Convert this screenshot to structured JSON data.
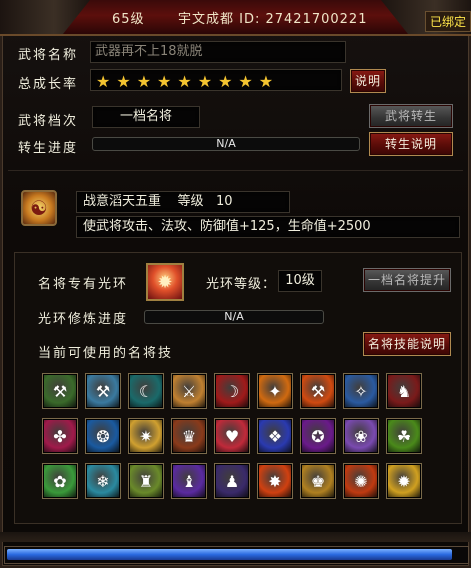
{
  "header": {
    "level": "65级",
    "player": "宇文成都 ID: 27421700221",
    "bound": "已绑定"
  },
  "general": {
    "name_label": "武将名称",
    "name_value": "武器再不上18就脱",
    "growth_label": "总成长率",
    "stars": "★★★★★★★★★",
    "growth_help": "说明",
    "tier_label": "武将档次",
    "tier_value": "一档名将",
    "reborn_btn": "武将转生",
    "reborn_progress_label": "转生进度",
    "reborn_progress_value": "N/A",
    "reborn_help": "转生说明"
  },
  "aura_buff": {
    "name": "战意滔天五重",
    "level_label": "等级",
    "level_value": "10",
    "desc": "使武将攻击、法攻、防御值+125，生命值+2500"
  },
  "aura": {
    "label": "名将专有光环",
    "level_label": "光环等级：",
    "level_value": "10级",
    "upgrade_btn": "一档名将提升",
    "train_label": "光环修炼进度",
    "train_value": "N/A",
    "skills_label": "当前可使用的名将技",
    "skills_help": "名将技能说明"
  },
  "skills": [
    {
      "icon": "axe-icon",
      "color": "#3a6a2a"
    },
    {
      "icon": "hammer-icon",
      "color": "#3a7aa0"
    },
    {
      "icon": "wave-slash-icon",
      "color": "#1a6a6a"
    },
    {
      "icon": "sword-icon",
      "color": "#c08030"
    },
    {
      "icon": "crescent-slash-icon",
      "color": "#a01a1a"
    },
    {
      "icon": "fire-slash-icon",
      "color": "#d06a10"
    },
    {
      "icon": "flame-hammer-icon",
      "color": "#d04a10"
    },
    {
      "icon": "ice-spear-icon",
      "color": "#2a5aa0"
    },
    {
      "icon": "warrior-icon",
      "color": "#7a1a1a"
    },
    {
      "icon": "claw-icon",
      "color": "#a01a4a"
    },
    {
      "icon": "wind-blade-icon",
      "color": "#1a5aa0"
    },
    {
      "icon": "golden-strike-icon",
      "color": "#d0a030"
    },
    {
      "icon": "dragon-icon",
      "color": "#8a3a1a"
    },
    {
      "icon": "heart-icon",
      "color": "#c02a3a"
    },
    {
      "icon": "vortex-icon",
      "color": "#2a3ab0"
    },
    {
      "icon": "demon-icon",
      "color": "#6a1a8a"
    },
    {
      "icon": "spiral-icon",
      "color": "#7a4ab0"
    },
    {
      "icon": "poison-icon",
      "color": "#4a8a1a"
    },
    {
      "icon": "nature-icon",
      "color": "#3a9a3a"
    },
    {
      "icon": "water-spirit-icon",
      "color": "#2a8aa0"
    },
    {
      "icon": "earth-golem-icon",
      "color": "#6a8a2a"
    },
    {
      "icon": "mage-icon",
      "color": "#5a2aa0"
    },
    {
      "icon": "shadow-warrior-icon",
      "color": "#3a2a6a"
    },
    {
      "icon": "fire-burst-icon",
      "color": "#d04010"
    },
    {
      "icon": "golden-guard-icon",
      "color": "#b08020"
    },
    {
      "icon": "flame-spirit-icon",
      "color": "#c03a10"
    },
    {
      "icon": "explosion-icon",
      "color": "#d0a020"
    }
  ],
  "exp_progress": 0.97
}
